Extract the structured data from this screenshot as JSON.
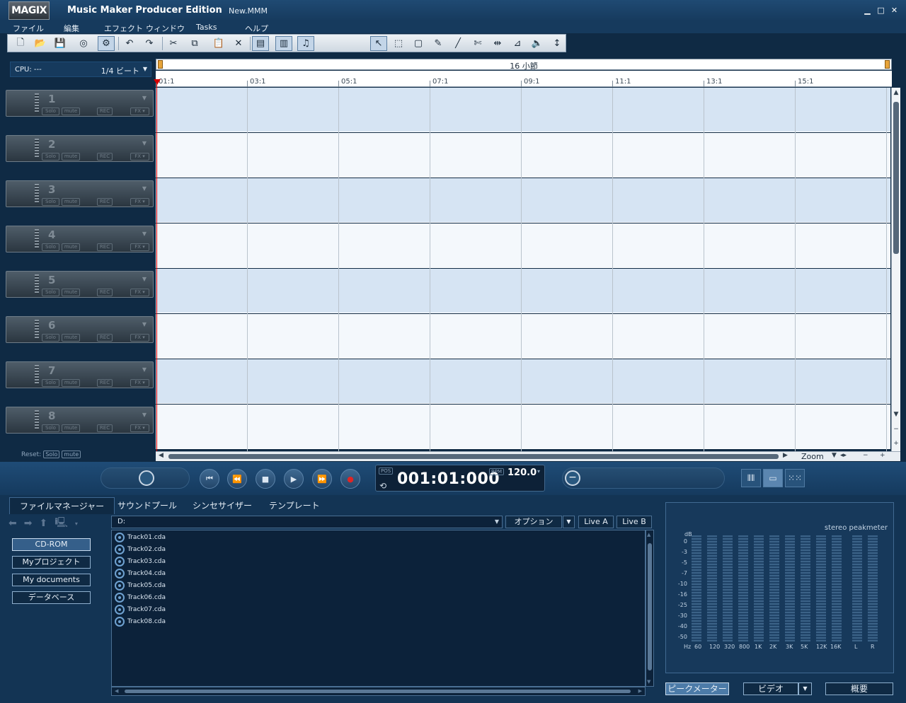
{
  "titlebar": {
    "logo": "MAGIX",
    "app_title": "Music Maker Producer Edition",
    "file_name": "New.MMM"
  },
  "window_controls": {
    "minimize": "▁",
    "maximize": "□",
    "close": "✕"
  },
  "menu": [
    "ファイル",
    "編集",
    "エフェクト",
    "ウィンドウ",
    "Tasks",
    "ヘルプ"
  ],
  "toolbar": {
    "buttons": [
      {
        "name": "new-icon",
        "glyph": "🗋"
      },
      {
        "name": "open-icon",
        "glyph": "📂"
      },
      {
        "name": "save-icon",
        "glyph": "💾"
      },
      {
        "name": "burn-icon",
        "glyph": "◎"
      },
      {
        "name": "settings-icon",
        "glyph": "⚙"
      },
      {
        "name": "undo-icon",
        "glyph": "↶"
      },
      {
        "name": "redo-icon",
        "glyph": "↷"
      },
      {
        "name": "cut-icon",
        "glyph": "✂"
      },
      {
        "name": "copy-icon",
        "glyph": "⧉"
      },
      {
        "name": "paste-icon",
        "glyph": "📋"
      },
      {
        "name": "delete-icon",
        "glyph": "✕"
      },
      {
        "name": "group-icon",
        "glyph": "▤"
      },
      {
        "name": "ungroup-icon",
        "glyph": "▥"
      },
      {
        "name": "notes-icon",
        "glyph": "♫"
      },
      {
        "name": "pointer-icon",
        "glyph": "↖"
      },
      {
        "name": "range-select-icon",
        "glyph": "⬚"
      },
      {
        "name": "object-select-icon",
        "glyph": "▢"
      },
      {
        "name": "draw-icon",
        "glyph": "✎"
      },
      {
        "name": "line-icon",
        "glyph": "╱"
      },
      {
        "name": "split-icon",
        "glyph": "✄"
      },
      {
        "name": "stretch-icon",
        "glyph": "⇹"
      },
      {
        "name": "fade-icon",
        "glyph": "⊿"
      },
      {
        "name": "volume-icon",
        "glyph": "🔈"
      },
      {
        "name": "height-icon",
        "glyph": "↕"
      }
    ]
  },
  "cpu": {
    "label": "CPU: ---",
    "snap": "1/4 ビート",
    "arrow": "▼"
  },
  "tracks": [
    {
      "num": "1"
    },
    {
      "num": "2"
    },
    {
      "num": "3"
    },
    {
      "num": "4"
    },
    {
      "num": "5"
    },
    {
      "num": "6"
    },
    {
      "num": "7"
    },
    {
      "num": "8"
    }
  ],
  "track_buttons": {
    "solo": "Solo",
    "mute": "mute",
    "rec": "REC",
    "fx": "FX ▾",
    "arrow": "▼"
  },
  "reset": {
    "label": "Reset:",
    "solo": "Solo",
    "mute": "mute"
  },
  "arrange": {
    "range_label": "16 小節",
    "ruler": [
      "01:1",
      "03:1",
      "05:1",
      "07:1",
      "09:1",
      "11:1",
      "13:1",
      "15:1"
    ],
    "zoom_label": "Zoom"
  },
  "scroll": {
    "up": "▲",
    "down": "▼",
    "minus": "−",
    "plus": "+",
    "left": "◀",
    "right": "▶",
    "zoom_arrow": "▼",
    "zoom_both": "◂▸",
    "zoom_minus": "−",
    "zoom_plus": "+"
  },
  "transport": {
    "pos_tag": "POS",
    "position": "001:01:000",
    "bpm_tag": "BPM",
    "bpm": "120.0",
    "bpm_arrow": "▾",
    "loop": "⟲",
    "rewind_start": "⏮",
    "rewind": "⏪",
    "stop": "■",
    "play": "▶",
    "forward": "⏩",
    "record": "●",
    "zoom_knob": "−",
    "view1": "⦀⦀",
    "view2": "▭",
    "view3": "⁙⁙"
  },
  "media_tabs": [
    "ファイルマネージャー",
    "サウンドプール",
    "シンセサイザー",
    "テンプレート"
  ],
  "nav": {
    "back": "⬅",
    "forward": "➡",
    "up": "⬆",
    "drive": "🖳",
    "drive_arrow": "▾"
  },
  "locations": [
    "CD-ROM",
    "Myプロジェクト",
    "My documents",
    "データベース"
  ],
  "path": {
    "value": "D:",
    "arrow": "▼"
  },
  "panel_buttons": {
    "options": "オプション",
    "options_arrow": "▼",
    "live_a": "Live A",
    "live_b": "Live B"
  },
  "files": [
    "Track01.cda",
    "Track02.cda",
    "Track03.cda",
    "Track04.cda",
    "Track05.cda",
    "Track06.cda",
    "Track07.cda",
    "Track08.cda"
  ],
  "filelist_scroll": {
    "up": "▲",
    "down": "▼",
    "left": "◀",
    "right": "▶"
  },
  "peakmeter": {
    "title": "stereo peakmeter",
    "db_label": "dB",
    "scale": [
      "0",
      "-3",
      "-5",
      "-7",
      "-10",
      "-16",
      "-25",
      "-30",
      "-40",
      "-50"
    ],
    "freqs": [
      "Hz",
      "60",
      "120",
      "320",
      "800",
      "1K",
      "2K",
      "3K",
      "5K",
      "12K",
      "16K",
      "L",
      "R"
    ]
  },
  "bottom_tabs": {
    "peak": "ピークメーター",
    "video": "ビデオ",
    "video_arrow": "▼",
    "overview": "概要"
  },
  "colors": {
    "lane_odd": "#d6e4f3",
    "lane_even": "#f4f8fc",
    "playhead": "#e00000",
    "accent": "#4c7ba8"
  }
}
